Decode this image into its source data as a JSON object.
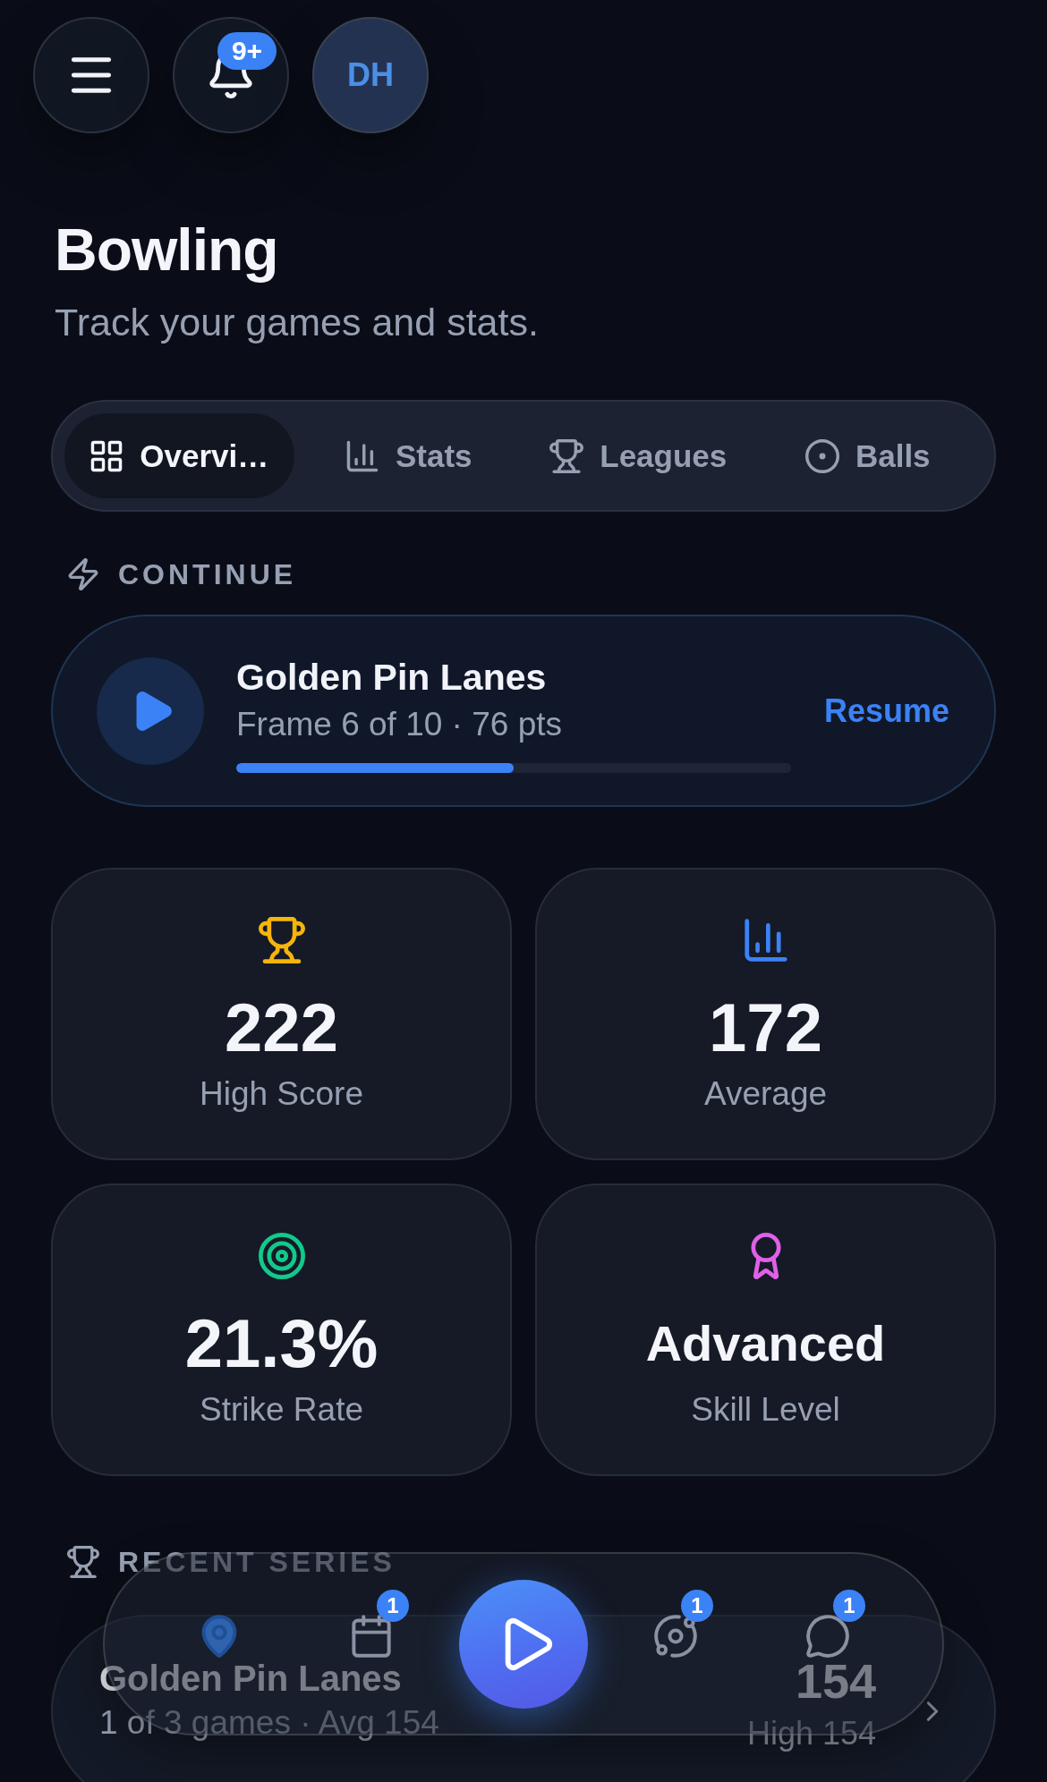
{
  "header": {
    "notification_badge": "9+",
    "avatar_initials": "DH"
  },
  "page": {
    "title": "Bowling",
    "subtitle": "Track your games and stats."
  },
  "tabs": [
    {
      "label": "Overvi…",
      "selected": true
    },
    {
      "label": "Stats",
      "selected": false
    },
    {
      "label": "Leagues",
      "selected": false
    },
    {
      "label": "Balls",
      "selected": false
    }
  ],
  "continue_section": {
    "heading": "CONTINUE",
    "title": "Golden Pin Lanes",
    "subtitle": "Frame 6 of 10 · 76 pts",
    "level": 0.5,
    "action": "Resume"
  },
  "stats": [
    {
      "kind": "number",
      "value": "222",
      "label": "High Score",
      "color": "#f5b50b"
    },
    {
      "kind": "number",
      "value": "172",
      "label": "Average",
      "color": "#3b82f6"
    },
    {
      "kind": "number",
      "value": "21.3%",
      "label": "Strike Rate",
      "color": "#12c98c"
    },
    {
      "kind": "text",
      "value": "Advanced",
      "label": "Skill Level",
      "color": "#e060e8"
    }
  ],
  "recent_series": {
    "heading": "RECENT SERIES",
    "items": [
      {
        "title": "Golden Pin Lanes",
        "subtitle": "1 of 3 games · Avg 154",
        "score": "154",
        "high": "High 154"
      }
    ]
  },
  "bottom_nav": {
    "items": [
      {
        "selected": true
      },
      {
        "selected": false,
        "badge": "1"
      },
      {
        "selected": false,
        "badge": "1"
      },
      {
        "selected": false,
        "badge": "1"
      }
    ]
  }
}
